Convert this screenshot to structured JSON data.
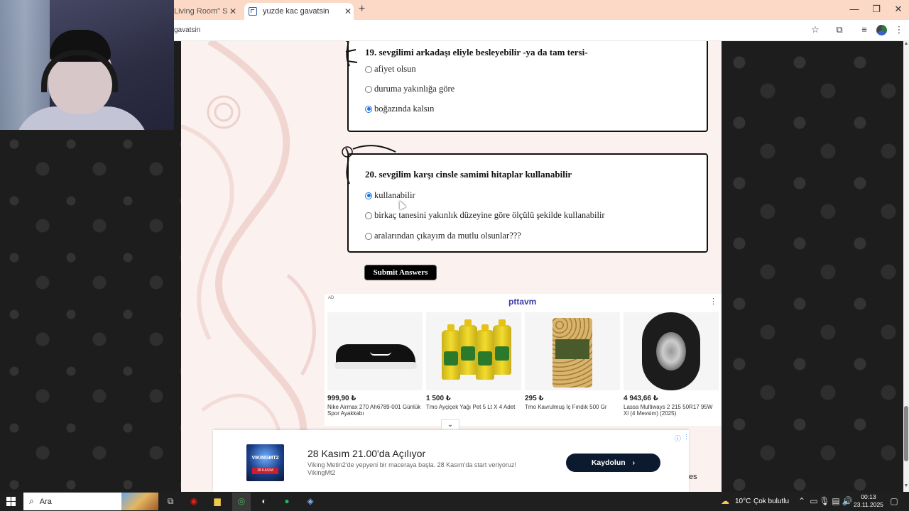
{
  "browser": {
    "tabs": [
      {
        "label": "Living Room\" Sound"
      },
      {
        "label": "yuzde kac gavatsin"
      }
    ],
    "address_text": "gavatsin",
    "new_tab_icon": "plus-icon"
  },
  "quiz": {
    "questions": [
      {
        "number": "19.",
        "text": "sevgilimi arkadaşı eliyle besleyebilir -ya da tam tersi-",
        "options": [
          "afiyet olsun",
          "duruma yakınlığa göre",
          "boğazında kalsın"
        ],
        "selected": 2
      },
      {
        "number": "20.",
        "text": "sevgilim karşı cinsle samimi hitaplar kullanabilir",
        "options": [
          "kullanabilir",
          "birkaç tanesini yakınlık düzeyine göre ölçülü şekilde kullanabilir",
          "aralarından çıkayım da mutlu olsunlar???"
        ],
        "selected": 0
      }
    ],
    "submit_label": "Submit Answers"
  },
  "ad": {
    "label": "AD",
    "brand": "pttavm",
    "products": [
      {
        "price": "999,90 ₺",
        "name": "Nike Airmax 270 Ah6789-001 Günlük Spor Ayakkabı"
      },
      {
        "price": "1 500 ₺",
        "name": "Tmo Ayçiçek Yağı Pet 5 Lt X 4 Adet"
      },
      {
        "price": "295 ₺",
        "name": "Tmo Kavrulmuş İç Fındık 500 Gr"
      },
      {
        "price": "4 943,66 ₺",
        "name": "Lassa Multiways 2 215 50R17 95W Xl (4 Mevsim) (2025)"
      }
    ]
  },
  "banner": {
    "logo_text": "VIKINGMT2",
    "logo_date": "28 KASIM",
    "title": "28 Kasım 21.00'da Açılıyor",
    "description": "Viking Metin2'de yepyeni bir maceraya başla. 28 Kasım'da start veriyoruz! VikingMt2",
    "cta": "Kaydolun",
    "peek_text": "es"
  },
  "taskbar": {
    "search_placeholder": "Ara",
    "weather": "10°C",
    "weather_desc": "Çok bulutlu",
    "time": "00:13",
    "date": "23.11.2025"
  },
  "colors": {
    "tab_bar": "#fbd9c6",
    "page_bg": "#fbf1ef",
    "radio_selected": "#1a73e8",
    "cta_bg": "#0b1a2e",
    "brand": "#3b3ba8"
  }
}
